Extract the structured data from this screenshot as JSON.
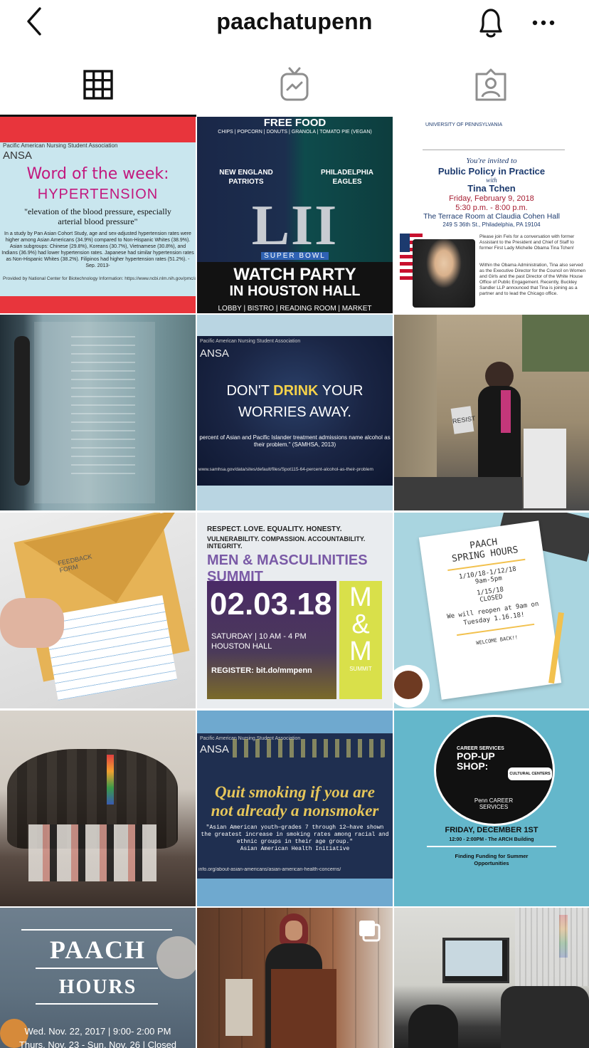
{
  "header": {
    "username": "paachatupenn",
    "back_icon": "chevron-left-icon",
    "notification_icon": "bell-icon",
    "more_icon": "more-horizontal-icon"
  },
  "tabs": [
    {
      "name": "posts-grid",
      "icon": "grid-icon",
      "active": true
    },
    {
      "name": "igtv",
      "icon": "igtv-icon",
      "active": false
    },
    {
      "name": "tagged",
      "icon": "tagged-person-icon",
      "active": false
    }
  ],
  "posts": [
    {
      "org": "Pacific American Nursing Student Association",
      "heading": "Word of the week:",
      "topic": "HYPERTENSION",
      "definition": "\"elevation of the blood pressure, especially arterial blood pressure\"",
      "body": "In a study by Pan Asian Cohort Study, age and sex-adjusted hypertension rates were higher among Asian Americans (34.9%) compared to Non-Hispanic Whites (38.9%). Asian subgroups: Chinese (29.8%), Koreans (30.7%), Vietnamese (30.8%), and Indians (36.9%) had lower hypertension rates. Japanese had similar hypertension rates as Non-Hispanic Whites (38.2%). Filipinos had higher hypertension rates (51.2%). -Sep. 2013-",
      "source": "Provided by National Center for Biotechnology Information: https://www.ncbi.nlm.nih.gov/pmc/articles/P"
    },
    {
      "free_food": "FREE FOOD",
      "food_list": "CHIPS | POPCORN | DONUTS | GRANOLA | TOMATO PIE (VEGAN)",
      "team1": "NEW ENGLAND PATRIOTS",
      "team2": "PHILADELPHIA EAGLES",
      "numeral": "LII",
      "superbowl": "SUPER BOWL",
      "watch": "WATCH PARTY",
      "hall": "IN HOUSTON HALL",
      "rooms": "LOBBY | BISTRO | READING ROOM | MARKET"
    },
    {
      "school": "UNIVERSITY OF PENNSYLVANIA",
      "invited": "You're invited to",
      "event": "Public Policy in Practice",
      "with": "with",
      "speaker": "Tina Tchen",
      "date": "Friday, February 9, 2018",
      "time": "5:30 p.m. - 8:00 p.m.",
      "venue": "The Terrace Room at Claudia Cohen Hall",
      "address": "249 S 36th St., Philadelphia, PA 19104",
      "bio1": "Please join Fels for a conversation with former Assistant to the President and Chief of Staff to former First Lady Michelle Obama Tina Tchen!",
      "bio2": "Within the Obama Administration, Tina also served as the Executive Director for the Council on Women and Girls and the past Director of the White House Office of Public Engagement. Recently, Buckley Sandler LLP announced that Tina is joining as a partner and to lead the Chicago office."
    },
    {
      "kind": "photo-poem-wall"
    },
    {
      "org": "Pacific American Nursing Student Association",
      "line1a": "DON'T ",
      "line1b": "DRINK",
      "line1c": " YOUR",
      "line2": "WORRIES AWAY.",
      "stat": "percent of Asian and Pacific Islander treatment admissions name alcohol as their problem.\" (SAMHSA, 2013)",
      "url": "www.samhsa.gov/data/sites/default/files/Spot115-64-percent-alcohol-as-their-problem"
    },
    {
      "kind": "photo-speaker-rally",
      "sign": "RESIST"
    },
    {
      "kind": "photo-feedback-envelope",
      "envelope_text": "FEEDBACK FORM"
    },
    {
      "values1": "RESPECT. LOVE. EQUALITY. HONESTY.",
      "values2": "VULNERABILITY. COMPASSION. ACCOUNTABILITY. INTEGRITY.",
      "title": "MEN & MASCULINITIES SUMMIT",
      "date": "02.03.18",
      "time": "SATURDAY | 10 AM - 4 PM",
      "place": "HOUSTON HALL",
      "register": "REGISTER: bit.do/mmpenn",
      "logo1": "M",
      "logo2": "&",
      "logo3": "M",
      "logo_sub": "SUMMIT"
    },
    {
      "title1": "PAACH",
      "title2": "SPRING HOURS",
      "dates": "1/10/18-1/12/18",
      "hours": "9am-5pm",
      "closed_date": "1/15/18",
      "closed": "CLOSED",
      "reopen": "We will reopen at 9am on Tuesday 1.16.18!",
      "welcome": "WELCOME BACK!!"
    },
    {
      "kind": "photo-group"
    },
    {
      "org": "Pacific American Nursing Student Association",
      "headline1": "Quit smoking if you are",
      "headline2": "not already a nonsmoker",
      "quote": "\"Asian American youth—grades 7 through 12—have shown the greatest increase in smoking rates among racial and ethnic groups in their age group.\"",
      "attribution": "Asian American Health Initiative",
      "url": "info.org/about-asian-americans/asian-american-health-concerns/"
    },
    {
      "bubble1": "CAREER SERVICES",
      "bubble2": "POP-UP",
      "bubble3": "SHOP:",
      "bubble4": "CULTURAL CENTERS",
      "logo": "Penn CAREER SERVICES",
      "date": "FRIDAY, DECEMBER 1ST",
      "time": "12:00 - 2:00PM - The ARCH Building",
      "topic": "Finding Funding for Summer Opportunities"
    },
    {
      "title1": "PAACH",
      "title2": "HOURS",
      "line1": "Wed. Nov. 22, 2017 | 9:00- 2:00 PM",
      "line2": "Thurs. Nov. 23 - Sun. Nov. 26 | Closed"
    },
    {
      "kind": "photo-speaker-podium",
      "multi_icon": "multiple-posts-icon"
    },
    {
      "kind": "photo-lounge"
    }
  ],
  "colors": {
    "accent_red": "#e8353c",
    "paach_blue": "#64b7cb"
  }
}
